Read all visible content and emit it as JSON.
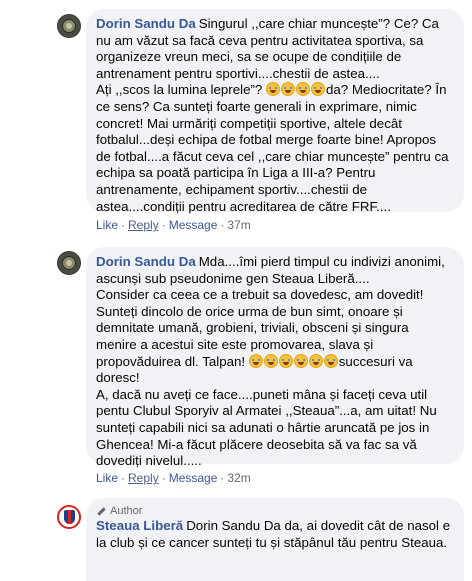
{
  "comments": [
    {
      "author": "Dorin Sandu Da",
      "text_a": "Singurul ,,care chiar muncește”? Ce? Ca nu am văzut sa facă ceva pentru activitatea sportiva, sa organizeze vreun meci, sa se ocupe de condițiile de antrenament pentru sportivi....chestii de astea....\nAți ,,scos la lumina leprele”? ",
      "text_b": "da? Mediocritate? În ce sens? Ca sunteți foarte generali in exprimare, nimic concret! Mai urmăriți competiții sportive, altele decât fotbalul...deși echipa de fotbal merge foarte bine! Apropos de fotbal....a făcut ceva cel ,,care chiar muncește” pentru ca echipa sa poată participa în Liga a III-a? Pentru antrenamente, echipament sportiv....chestii de astea....condiții pentru acreditarea de către FRF....",
      "emoji_count": 4,
      "like": "Like",
      "reply": "Reply",
      "message": "Message",
      "time": "37m"
    },
    {
      "author": "Dorin Sandu Da",
      "text_a": "Mda....îmi pierd timpul cu indivizi anonimi, ascunși sub pseudonime gen Steaua Liberă....\nConsider ca ceea ce a trebuit sa dovedesc, am dovedit! Sunteți dincolo de orice urma de bun simt, onoare și demnitate umană, grobieni, triviali, obsceni și singura menire a acestui site este promovarea, slava și propovăduirea dl. Talpan! ",
      "text_b": "succesuri va doresc!\nA, dacă nu aveți ce face....puneti mâna și faceți ceva util pentu Clubul Sporyiv al Armatei ,,Steaua”...a, am uitat! Nu sunteți capabili nici sa adunati o hârtie aruncată pe jos in Ghencea! Mi-a făcut plăcere deosebita să va fac sa vă dovediți nivelul.....",
      "emoji_count": 6,
      "like": "Like",
      "reply": "Reply",
      "message": "Message",
      "time": "32m"
    },
    {
      "badge": "Author",
      "author": "Steaua Liberă",
      "text_a": "Dorin Sandu Da da, ai dovedit cât de nasol e la club și ce cancer sunteți tu și stăpânul tău pentru Steaua."
    }
  ]
}
